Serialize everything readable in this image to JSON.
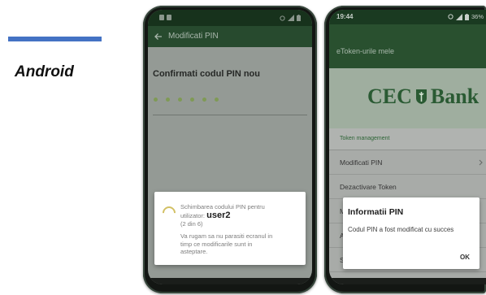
{
  "slide": {
    "platform_label": "Android"
  },
  "colors": {
    "accent_bar": "#4472c4",
    "brand_green": "#2a5a33",
    "header_green": "#29502f",
    "spinner": "#d2c064",
    "pin_dot": "#7f9a55"
  },
  "phone1": {
    "app_bar": {
      "back_icon": "arrow-left-icon",
      "title": "Modificati PIN"
    },
    "content": {
      "prompt": "Confirmati codul PIN nou",
      "pin_dots_count": 6
    },
    "dialog": {
      "spinner_icon": "loading-spinner-icon",
      "message_line1": "Schimbarea codului PIN pentru",
      "user_label": "utilizator:",
      "user_name": "user2",
      "step": "(2 din 6)",
      "warning": "Va rugam sa nu parasiti ecranul in timp ce modificarile sunt in asteptare."
    }
  },
  "phone2": {
    "status_bar": {
      "time": "19:44",
      "battery": "36%"
    },
    "header_title": "eToken-urile mele",
    "logo": {
      "word_before_icon": "CEC",
      "icon": "cec-shield-logo-icon",
      "word_after_icon": "Bank"
    },
    "section_header": "Token management",
    "menu_items": [
      {
        "label": "Modificati PIN",
        "icon": "chevron-right-icon"
      },
      {
        "label": "Dezactivare Token"
      },
      {
        "label": "M"
      },
      {
        "label": "A"
      },
      {
        "label": "S"
      }
    ],
    "dialog": {
      "title": "Informatii PIN",
      "message": "Codul PIN a fost modificat cu succes",
      "ok_label": "OK"
    }
  }
}
